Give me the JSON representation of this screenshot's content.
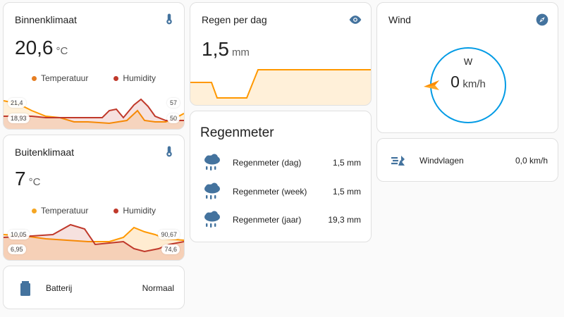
{
  "colors": {
    "temperature": "#ff9800",
    "humidity": "#c0392b",
    "accent": "#039be5",
    "icon_blue": "#44739e"
  },
  "binnenklimaat": {
    "title": "Binnenklimaat",
    "icon": "thermometer-icon",
    "value": "20,6",
    "unit": "°C",
    "legend": {
      "temperature": "Temperatuur",
      "humidity": "Humidity"
    },
    "labels": {
      "left_top": "21,4",
      "left_bottom": "18,93",
      "right_top": "57",
      "right_bottom": "50"
    }
  },
  "buitenklimaat": {
    "title": "Buitenklimaat",
    "icon": "thermometer-icon",
    "value": "7",
    "unit": "°C",
    "legend": {
      "temperature": "Temperatuur",
      "humidity": "Humidity"
    },
    "labels": {
      "left_top": "10,05",
      "left_bottom": "6,95",
      "right_top": "90,67",
      "right_bottom": "74,6"
    }
  },
  "batterij": {
    "icon": "battery-icon",
    "name": "Batterij",
    "value": "Normaal"
  },
  "regen_per_dag": {
    "title": "Regen per dag",
    "icon": "eye-icon",
    "value": "1,5",
    "unit": "mm"
  },
  "regenmeter": {
    "title": "Regenmeter",
    "rows": [
      {
        "icon": "rain-cloud-icon",
        "name": "Regenmeter (dag)",
        "value": "1,5 mm"
      },
      {
        "icon": "rain-cloud-icon",
        "name": "Regenmeter (week)",
        "value": "1,5 mm"
      },
      {
        "icon": "rain-cloud-icon",
        "name": "Regenmeter (jaar)",
        "value": "19,3 mm"
      }
    ]
  },
  "wind": {
    "title": "Wind",
    "icon": "compass-icon",
    "direction": "W",
    "value": "0",
    "unit": "km/h"
  },
  "windvlagen": {
    "icon": "wind-gust-icon",
    "name": "Windvlagen",
    "value": "0,0 km/h"
  }
}
